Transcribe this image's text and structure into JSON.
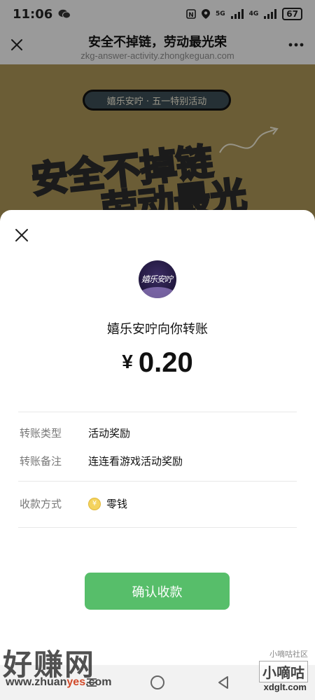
{
  "status_bar": {
    "time": "11:06",
    "battery": "67",
    "network_a": "5G",
    "network_b": "4G"
  },
  "title_bar": {
    "title": "安全不掉链，劳动最光荣",
    "url": "zkg-answer-activity.zhongkeguan.com"
  },
  "banner": {
    "pill_text": "嬉乐安咛 · 五一特别活动",
    "slogan_line1": "安全不掉链",
    "slogan_line2": "劳动最光荣！"
  },
  "transfer": {
    "avatar_text": "嬉乐安咛",
    "sender_text": "嬉乐安咛向你转账",
    "currency_symbol": "¥",
    "amount": "0.20",
    "details": [
      {
        "label": "转账类型",
        "value": "活动奖励"
      },
      {
        "label": "转账备注",
        "value": "连连看游戏活动奖励"
      }
    ],
    "payment": {
      "label": "收款方式",
      "value": "零钱",
      "coin_symbol": "¥"
    },
    "confirm_button": "确认收款"
  },
  "watermarks": {
    "left_title": "好赚网",
    "left_url_a": "www.zhuan",
    "left_url_b": "yes",
    "left_url_c": ".com",
    "right_top": "小嘀咕社区",
    "right_title": "小嘀咕",
    "right_url": "xdglt.com"
  }
}
